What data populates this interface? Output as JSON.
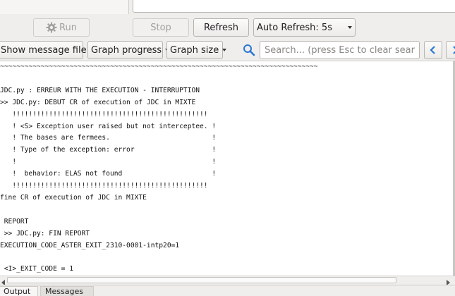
{
  "toolbar": {
    "run_label": "Run",
    "stop_label": "Stop",
    "refresh_label": "Refresh",
    "auto_refresh_label": "Auto Refresh: 5s",
    "show_message_file_label": "Show message file",
    "graph_progress_label": "Graph progress",
    "graph_size_label": "Graph size",
    "search_placeholder": "Search... (press Esc to clear search)"
  },
  "console": {
    "lines": [
      "~~~~~~~~~~~~~~~~~~~~~~~~~~~~~~~~~~~~~~~~~~~~~~~~~~~~~~~~~~~~~~~~~~~~~~~~~~~~~~",
      "",
      "JDC.py : ERREUR WITH THE EXECUTION - INTERRUPTION",
      ">> JDC.py: DEBUT CR of execution of JDC in MIXTE",
      "   !!!!!!!!!!!!!!!!!!!!!!!!!!!!!!!!!!!!!!!!!!!!!!!!",
      "   ! <S> Exception user raised but not interceptee. !",
      "   ! The bases are fermees.                         !",
      "   ! Type of the exception: error                   !",
      "   !                                                !",
      "   !  behavior: ELAS not found                      !",
      "   !!!!!!!!!!!!!!!!!!!!!!!!!!!!!!!!!!!!!!!!!!!!!!!!",
      "fine CR of execution of JDC in MIXTE",
      "",
      " REPORT",
      " >> JDC.py: FIN REPORT",
      "EXECUTION_CODE_ASTER_EXIT_2310-0001-intp20=1",
      "",
      " <I>_EXIT_CODE = 1"
    ]
  },
  "tabs": [
    {
      "label": "Output"
    },
    {
      "label": "Messages"
    }
  ],
  "icons": {
    "run": "gear-icon",
    "search": "search-icon",
    "prev": "chevron-left-icon",
    "next": "chevron-right-icon"
  },
  "colors": {
    "accent": "#2a76d2"
  }
}
